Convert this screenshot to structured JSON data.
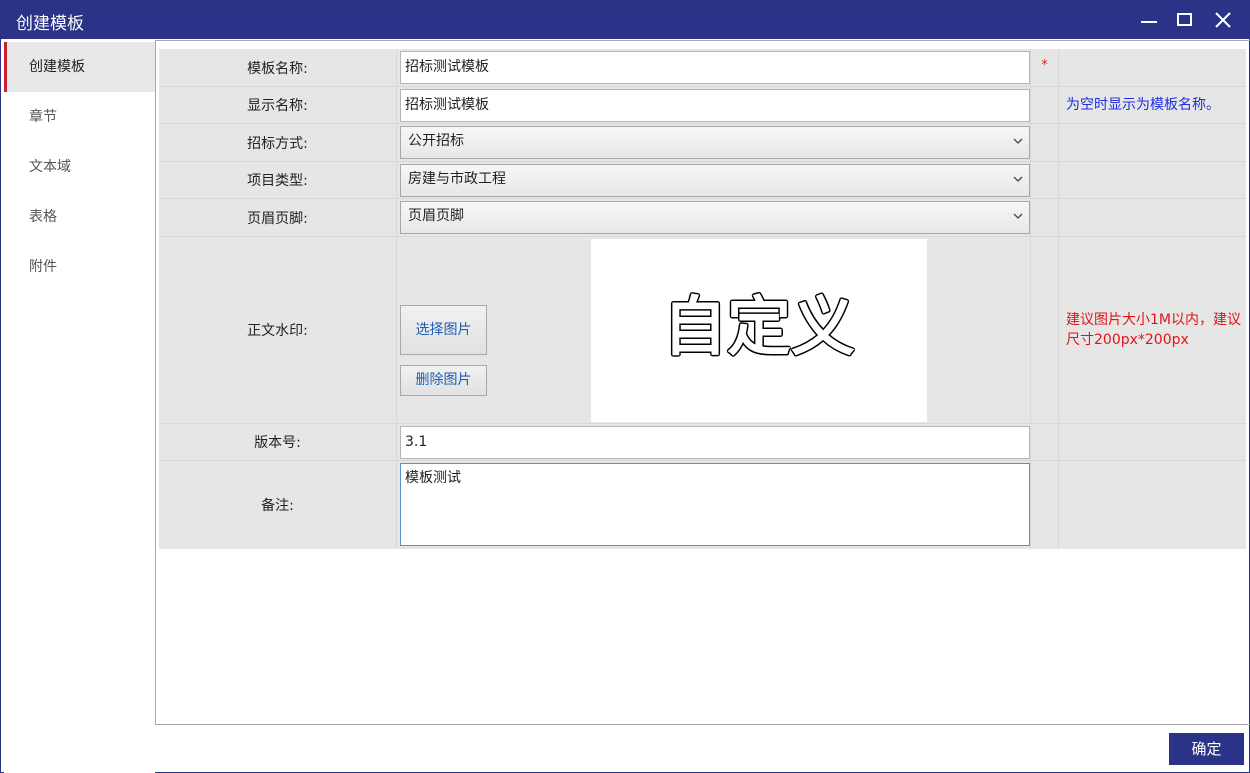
{
  "window": {
    "title": "创建模板"
  },
  "sidebar": {
    "items": [
      {
        "label": "创建模板",
        "active": true
      },
      {
        "label": "章节"
      },
      {
        "label": "文本域"
      },
      {
        "label": "表格"
      },
      {
        "label": "附件"
      }
    ]
  },
  "form": {
    "template_name": {
      "label": "模板名称:",
      "value": "招标测试模板",
      "required_mark": "*"
    },
    "display_name": {
      "label": "显示名称:",
      "value": "招标测试模板",
      "hint": "为空时显示为模板名称。"
    },
    "bidding_method": {
      "label": "招标方式:",
      "selected": "公开招标"
    },
    "project_type": {
      "label": "项目类型:",
      "selected": "房建与市政工程"
    },
    "header_footer": {
      "label": "页眉页脚:",
      "selected": "页眉页脚"
    },
    "watermark": {
      "label": "正文水印:",
      "select_button": "选择图片",
      "delete_button": "删除图片",
      "preview_text": "自定义",
      "hint": "建议图片大小1M以内，建议尺寸200px*200px"
    },
    "version": {
      "label": "版本号:",
      "value": "3.1"
    },
    "remark": {
      "label": "备注:",
      "value": "模板测试"
    }
  },
  "footer": {
    "confirm_label": "确定"
  },
  "colors": {
    "titlebar": "#2b3388",
    "active_marker": "#c8232c",
    "hint_blue": "#1f2ee0",
    "hint_red": "#e01515",
    "required": "#e02020"
  }
}
